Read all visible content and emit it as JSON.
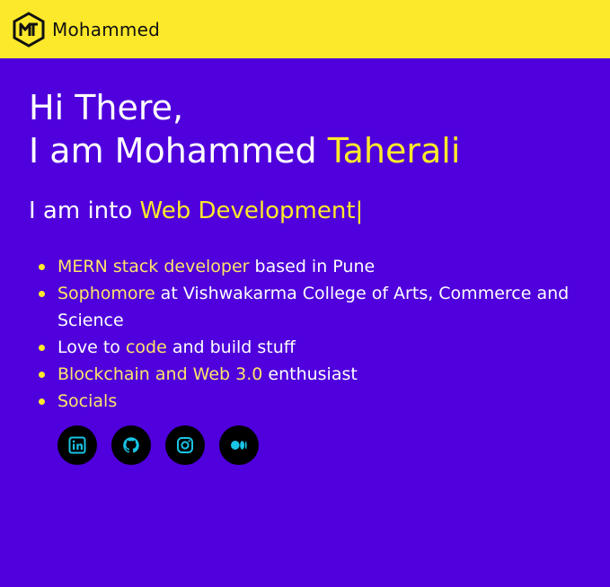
{
  "navbar": {
    "brand": "Mohammed",
    "logo_icon": "mt-monogram-icon",
    "background": "#fde92b"
  },
  "hero": {
    "line1": "Hi There,",
    "line2_prefix": "I am Mohammed ",
    "line2_highlight": "Taherali",
    "subtitle_prefix": "I am into ",
    "subtitle_highlight": "Web Development",
    "cursor": "|"
  },
  "bullets": [
    {
      "highlight": "MERN stack developer",
      "text": " based in Pune"
    },
    {
      "highlight": "Sophomore",
      "text": " at Vishwakarma College of Arts, Commerce and Science"
    },
    {
      "prefix": "Love to ",
      "highlight": "code",
      "text": " and build stuff"
    },
    {
      "highlight": "Blockchain and Web 3.0",
      "text": " enthusiast"
    },
    {
      "highlight": "Socials"
    }
  ],
  "socials": [
    {
      "icon": "linkedin-icon"
    },
    {
      "icon": "github-icon"
    },
    {
      "icon": "instagram-icon"
    },
    {
      "icon": "medium-icon"
    }
  ],
  "colors": {
    "background": "#4f00dc",
    "accent": "#fde92b",
    "icon": "#19c4e6"
  }
}
